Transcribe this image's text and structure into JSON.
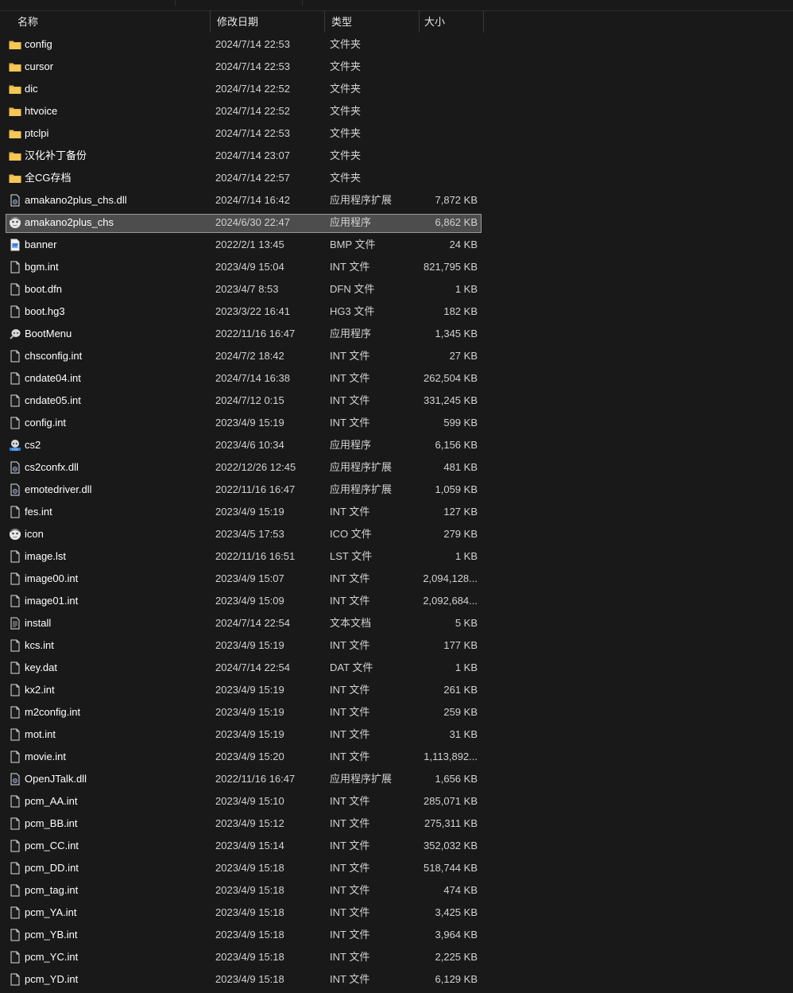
{
  "header": {
    "name": "名称",
    "modified": "修改日期",
    "type": "类型",
    "size": "大小",
    "sort_indicator": "sort-ascending-icon"
  },
  "colors": {
    "background": "#191919",
    "selected_row": "#4d4d4d",
    "selected_border": "#999999",
    "folder": "#e9b84a",
    "text": "#ffffff",
    "secondary_text": "#d2d2d2"
  },
  "files": [
    {
      "name": "config",
      "date": "2024/7/14 22:53",
      "type": "文件夹",
      "size": "",
      "icon": "folder-icon"
    },
    {
      "name": "cursor",
      "date": "2024/7/14 22:53",
      "type": "文件夹",
      "size": "",
      "icon": "folder-icon"
    },
    {
      "name": "dic",
      "date": "2024/7/14 22:52",
      "type": "文件夹",
      "size": "",
      "icon": "folder-icon"
    },
    {
      "name": "htvoice",
      "date": "2024/7/14 22:52",
      "type": "文件夹",
      "size": "",
      "icon": "folder-icon"
    },
    {
      "name": "ptclpi",
      "date": "2024/7/14 22:53",
      "type": "文件夹",
      "size": "",
      "icon": "folder-icon"
    },
    {
      "name": "汉化补丁备份",
      "date": "2024/7/14 23:07",
      "type": "文件夹",
      "size": "",
      "icon": "folder-icon"
    },
    {
      "name": "全CG存档",
      "date": "2024/7/14 22:57",
      "type": "文件夹",
      "size": "",
      "icon": "folder-icon"
    },
    {
      "name": "amakano2plus_chs.dll",
      "date": "2024/7/14 16:42",
      "type": "应用程序扩展",
      "size": "7,872 KB",
      "icon": "dll-file-icon"
    },
    {
      "name": "amakano2plus_chs",
      "date": "2024/6/30 22:47",
      "type": "应用程序",
      "size": "6,862 KB",
      "icon": "app-character-icon",
      "selected": true
    },
    {
      "name": "banner",
      "date": "2022/2/1 13:45",
      "type": "BMP 文件",
      "size": "24 KB",
      "icon": "bmp-image-icon"
    },
    {
      "name": "bgm.int",
      "date": "2023/4/9 15:04",
      "type": "INT 文件",
      "size": "821,795 KB",
      "icon": "file-icon"
    },
    {
      "name": "boot.dfn",
      "date": "2023/4/7 8:53",
      "type": "DFN 文件",
      "size": "1 KB",
      "icon": "file-icon"
    },
    {
      "name": "boot.hg3",
      "date": "2023/3/22 16:41",
      "type": "HG3 文件",
      "size": "182 KB",
      "icon": "file-icon"
    },
    {
      "name": "BootMenu",
      "date": "2022/11/16 16:47",
      "type": "应用程序",
      "size": "1,345 KB",
      "icon": "bootmenu-app-icon"
    },
    {
      "name": "chsconfig.int",
      "date": "2024/7/2 18:42",
      "type": "INT 文件",
      "size": "27 KB",
      "icon": "file-icon"
    },
    {
      "name": "cndate04.int",
      "date": "2024/7/14 16:38",
      "type": "INT 文件",
      "size": "262,504 KB",
      "icon": "file-icon"
    },
    {
      "name": "cndate05.int",
      "date": "2024/7/12 0:15",
      "type": "INT 文件",
      "size": "331,245 KB",
      "icon": "file-icon"
    },
    {
      "name": "config.int",
      "date": "2023/4/9 15:19",
      "type": "INT 文件",
      "size": "599 KB",
      "icon": "file-icon"
    },
    {
      "name": "cs2",
      "date": "2023/4/6 10:34",
      "type": "应用程序",
      "size": "6,156 KB",
      "icon": "cs2-app-icon"
    },
    {
      "name": "cs2confx.dll",
      "date": "2022/12/26 12:45",
      "type": "应用程序扩展",
      "size": "481 KB",
      "icon": "dll-file-icon"
    },
    {
      "name": "emotedriver.dll",
      "date": "2022/11/16 16:47",
      "type": "应用程序扩展",
      "size": "1,059 KB",
      "icon": "dll-file-icon"
    },
    {
      "name": "fes.int",
      "date": "2023/4/9 15:19",
      "type": "INT 文件",
      "size": "127 KB",
      "icon": "file-icon"
    },
    {
      "name": "icon",
      "date": "2023/4/5 17:53",
      "type": "ICO 文件",
      "size": "279 KB",
      "icon": "app-character-icon"
    },
    {
      "name": "image.lst",
      "date": "2022/11/16 16:51",
      "type": "LST 文件",
      "size": "1 KB",
      "icon": "file-icon"
    },
    {
      "name": "image00.int",
      "date": "2023/4/9 15:07",
      "type": "INT 文件",
      "size": "2,094,128...",
      "icon": "file-icon"
    },
    {
      "name": "image01.int",
      "date": "2023/4/9 15:09",
      "type": "INT 文件",
      "size": "2,092,684...",
      "icon": "file-icon"
    },
    {
      "name": "install",
      "date": "2024/7/14 22:54",
      "type": "文本文档",
      "size": "5 KB",
      "icon": "text-file-icon"
    },
    {
      "name": "kcs.int",
      "date": "2023/4/9 15:19",
      "type": "INT 文件",
      "size": "177 KB",
      "icon": "file-icon"
    },
    {
      "name": "key.dat",
      "date": "2024/7/14 22:54",
      "type": "DAT 文件",
      "size": "1 KB",
      "icon": "file-icon"
    },
    {
      "name": "kx2.int",
      "date": "2023/4/9 15:19",
      "type": "INT 文件",
      "size": "261 KB",
      "icon": "file-icon"
    },
    {
      "name": "m2config.int",
      "date": "2023/4/9 15:19",
      "type": "INT 文件",
      "size": "259 KB",
      "icon": "file-icon"
    },
    {
      "name": "mot.int",
      "date": "2023/4/9 15:19",
      "type": "INT 文件",
      "size": "31 KB",
      "icon": "file-icon"
    },
    {
      "name": "movie.int",
      "date": "2023/4/9 15:20",
      "type": "INT 文件",
      "size": "1,113,892...",
      "icon": "file-icon"
    },
    {
      "name": "OpenJTalk.dll",
      "date": "2022/11/16 16:47",
      "type": "应用程序扩展",
      "size": "1,656 KB",
      "icon": "dll-file-icon"
    },
    {
      "name": "pcm_AA.int",
      "date": "2023/4/9 15:10",
      "type": "INT 文件",
      "size": "285,071 KB",
      "icon": "file-icon"
    },
    {
      "name": "pcm_BB.int",
      "date": "2023/4/9 15:12",
      "type": "INT 文件",
      "size": "275,311 KB",
      "icon": "file-icon"
    },
    {
      "name": "pcm_CC.int",
      "date": "2023/4/9 15:14",
      "type": "INT 文件",
      "size": "352,032 KB",
      "icon": "file-icon"
    },
    {
      "name": "pcm_DD.int",
      "date": "2023/4/9 15:18",
      "type": "INT 文件",
      "size": "518,744 KB",
      "icon": "file-icon"
    },
    {
      "name": "pcm_tag.int",
      "date": "2023/4/9 15:18",
      "type": "INT 文件",
      "size": "474 KB",
      "icon": "file-icon"
    },
    {
      "name": "pcm_YA.int",
      "date": "2023/4/9 15:18",
      "type": "INT 文件",
      "size": "3,425 KB",
      "icon": "file-icon"
    },
    {
      "name": "pcm_YB.int",
      "date": "2023/4/9 15:18",
      "type": "INT 文件",
      "size": "3,964 KB",
      "icon": "file-icon"
    },
    {
      "name": "pcm_YC.int",
      "date": "2023/4/9 15:18",
      "type": "INT 文件",
      "size": "2,225 KB",
      "icon": "file-icon"
    },
    {
      "name": "pcm_YD.int",
      "date": "2023/4/9 15:18",
      "type": "INT 文件",
      "size": "6,129 KB",
      "icon": "file-icon"
    }
  ]
}
